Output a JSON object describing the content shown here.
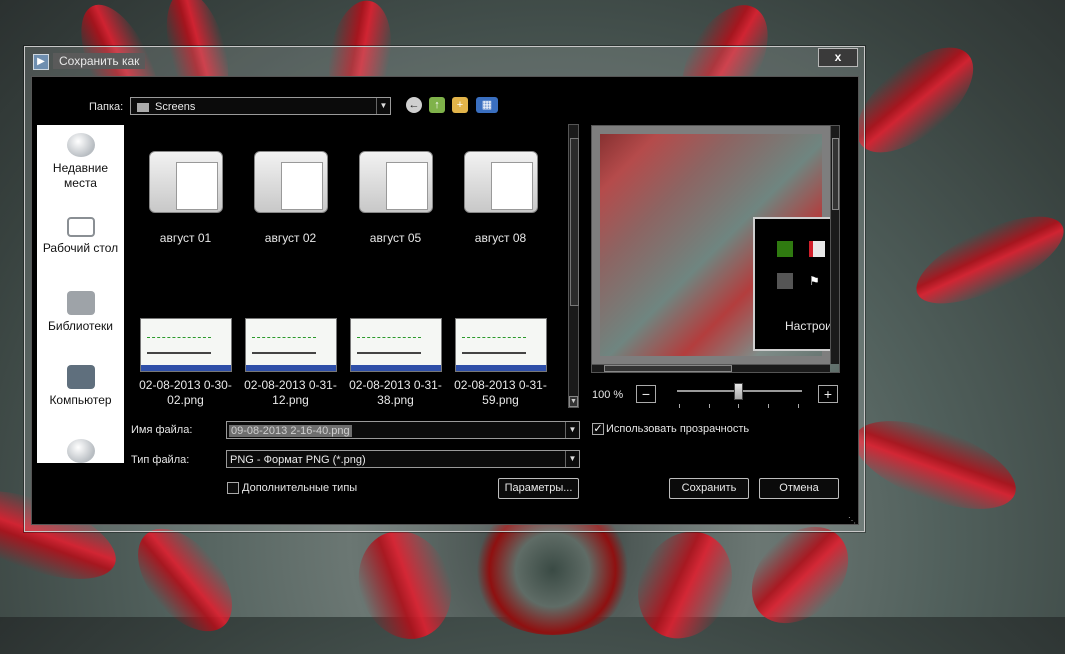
{
  "window": {
    "title": "Сохранить как",
    "close_label": "x"
  },
  "folder": {
    "label": "Папка:",
    "value": "Screens"
  },
  "toolbar": {
    "back_icon": "back-arrow-icon",
    "up_icon": "folder-up-icon",
    "new_folder_icon": "new-folder-icon",
    "view_icon": "view-menu-icon"
  },
  "places": [
    {
      "label": "Недавние места",
      "icon": "recent-places-icon"
    },
    {
      "label": "Рабочий стол",
      "icon": "desktop-icon"
    },
    {
      "label": "Библиотеки",
      "icon": "libraries-icon"
    },
    {
      "label": "Компьютер",
      "icon": "computer-icon"
    },
    {
      "label": "",
      "icon": "network-icon"
    }
  ],
  "files": [
    {
      "label": "август 01",
      "kind": "folder"
    },
    {
      "label": "август 02",
      "kind": "folder"
    },
    {
      "label": "август 05",
      "kind": "folder"
    },
    {
      "label": "август 08",
      "kind": "folder"
    },
    {
      "label": "02-08-2013 0-30-02.png",
      "kind": "image"
    },
    {
      "label": "02-08-2013 0-31-12.png",
      "kind": "image"
    },
    {
      "label": "02-08-2013 0-31-38.png",
      "kind": "image"
    },
    {
      "label": "02-08-2013 0-31-59.png",
      "kind": "image"
    }
  ],
  "filename": {
    "label": "Имя файла:",
    "value": "09-08-2013 2-16-40.png"
  },
  "filetype": {
    "label": "Тип файла:",
    "value": "PNG - Формат PNG (*.png)"
  },
  "extra_types": {
    "label": "Дополнительные типы",
    "checked": false
  },
  "params_button": "Параметры...",
  "preview": {
    "panel_text": "Настрои",
    "icons": [
      "nvidia-icon",
      "antivirus-icon",
      "app-icon",
      "flag-icon"
    ]
  },
  "zoom": {
    "value": "100 %",
    "minus": "−",
    "plus": "+",
    "level_percent": 47
  },
  "transparency": {
    "label": "Использовать прозрачность",
    "checked": true
  },
  "save_button": "Сохранить",
  "cancel_button": "Отмена",
  "colors": {
    "client_bg": "#000000",
    "accent_red": "#d11f2b"
  }
}
